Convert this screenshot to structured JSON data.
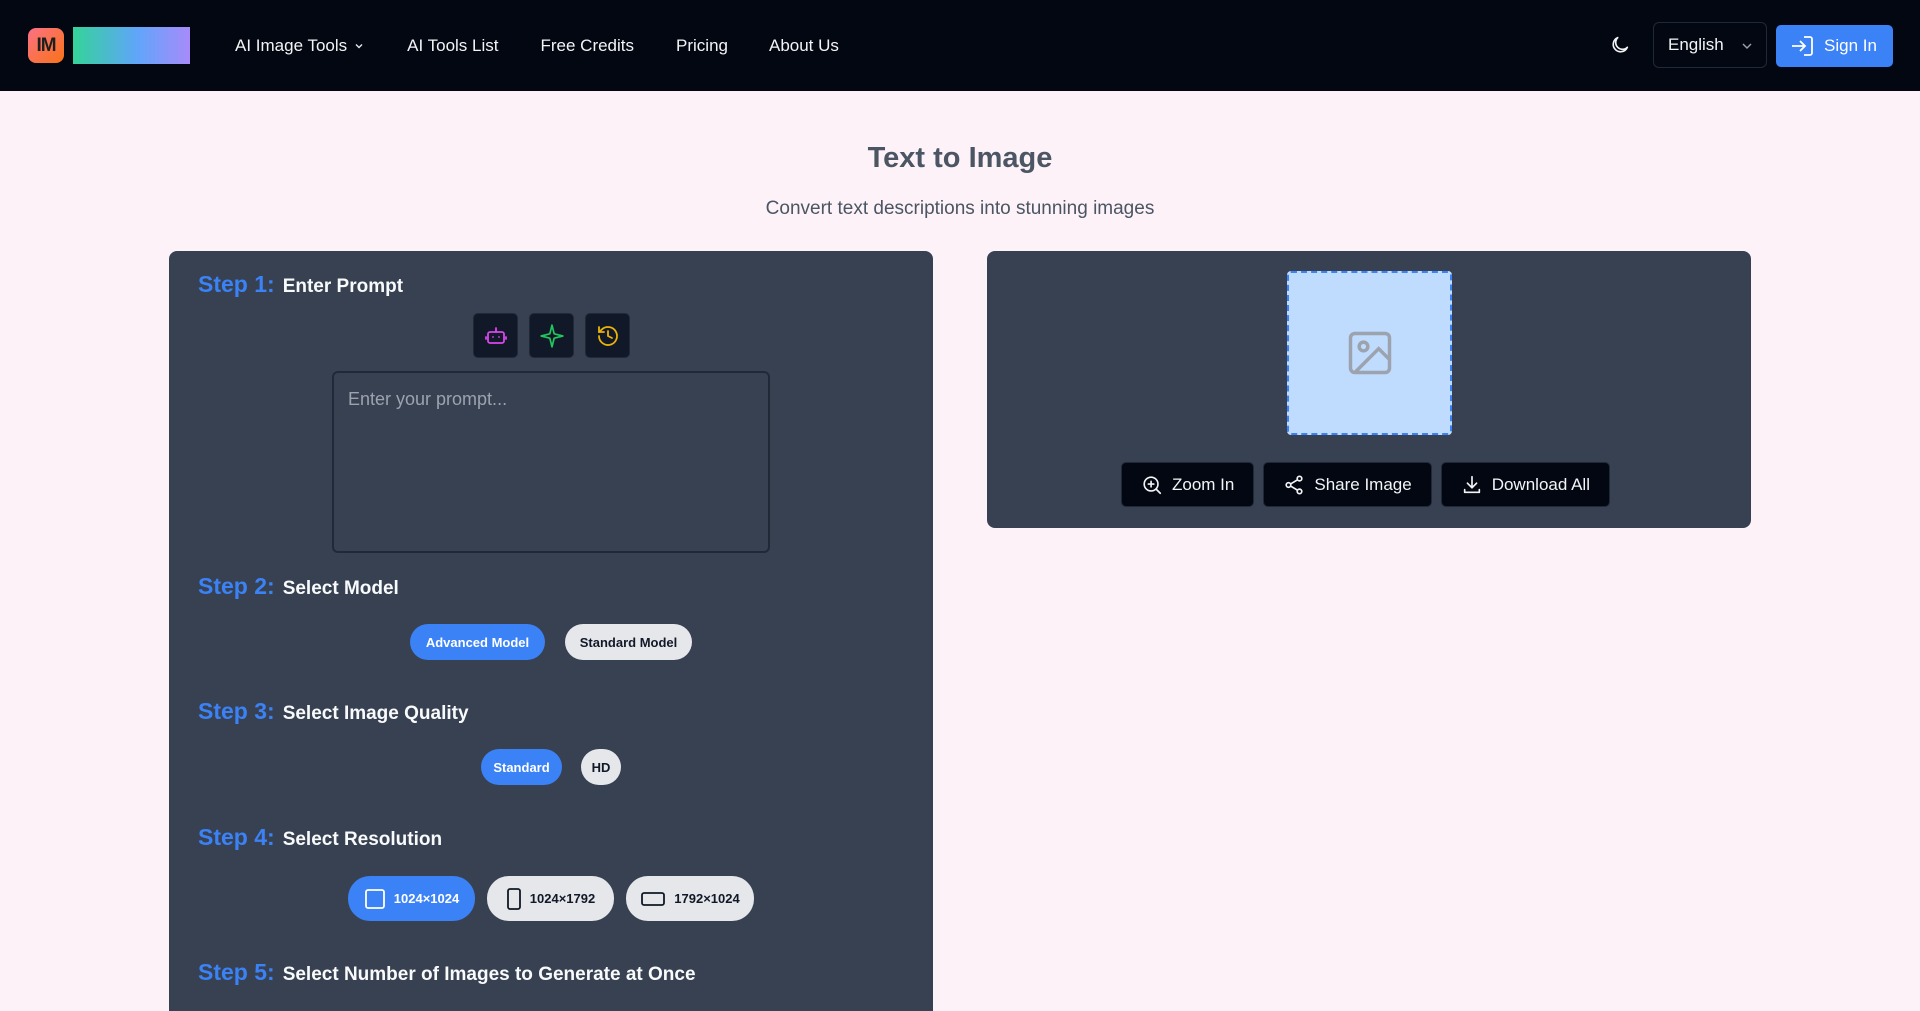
{
  "header": {
    "logo_text": "IM",
    "nav": [
      {
        "label": "AI Image Tools"
      },
      {
        "label": "AI Tools List"
      },
      {
        "label": "Free Credits"
      },
      {
        "label": "Pricing"
      },
      {
        "label": "About Us"
      }
    ],
    "language": "English",
    "sign_in": "Sign In"
  },
  "page": {
    "title": "Text to Image",
    "subtitle": "Convert text descriptions into stunning images"
  },
  "steps": [
    {
      "num": "Step 1:",
      "title": "Enter Prompt"
    },
    {
      "num": "Step 2:",
      "title": "Select Model"
    },
    {
      "num": "Step 3:",
      "title": "Select Image Quality"
    },
    {
      "num": "Step 4:",
      "title": "Select Resolution"
    },
    {
      "num": "Step 5:",
      "title": "Select Number of Images to Generate at Once"
    }
  ],
  "prompt": {
    "placeholder": "Enter your prompt...",
    "value": ""
  },
  "tools": [
    {
      "icon": "robot-icon"
    },
    {
      "icon": "sparkle-icon"
    },
    {
      "icon": "history-icon"
    }
  ],
  "models": {
    "selected": "Advanced Model",
    "options": [
      "Advanced Model",
      "Standard Model"
    ]
  },
  "quality": {
    "selected": "Standard",
    "options": [
      "Standard",
      "HD"
    ]
  },
  "resolution": {
    "selected": "1024×1024",
    "options": [
      "1024×1024",
      "1024×1792",
      "1792×1024"
    ]
  },
  "preview_actions": {
    "zoom": "Zoom In",
    "share": "Share Image",
    "download": "Download All"
  },
  "colors": {
    "accent": "#3b82f6",
    "panel": "#374151",
    "header_bg": "#030712",
    "page_bg": "#fdf2f8"
  }
}
